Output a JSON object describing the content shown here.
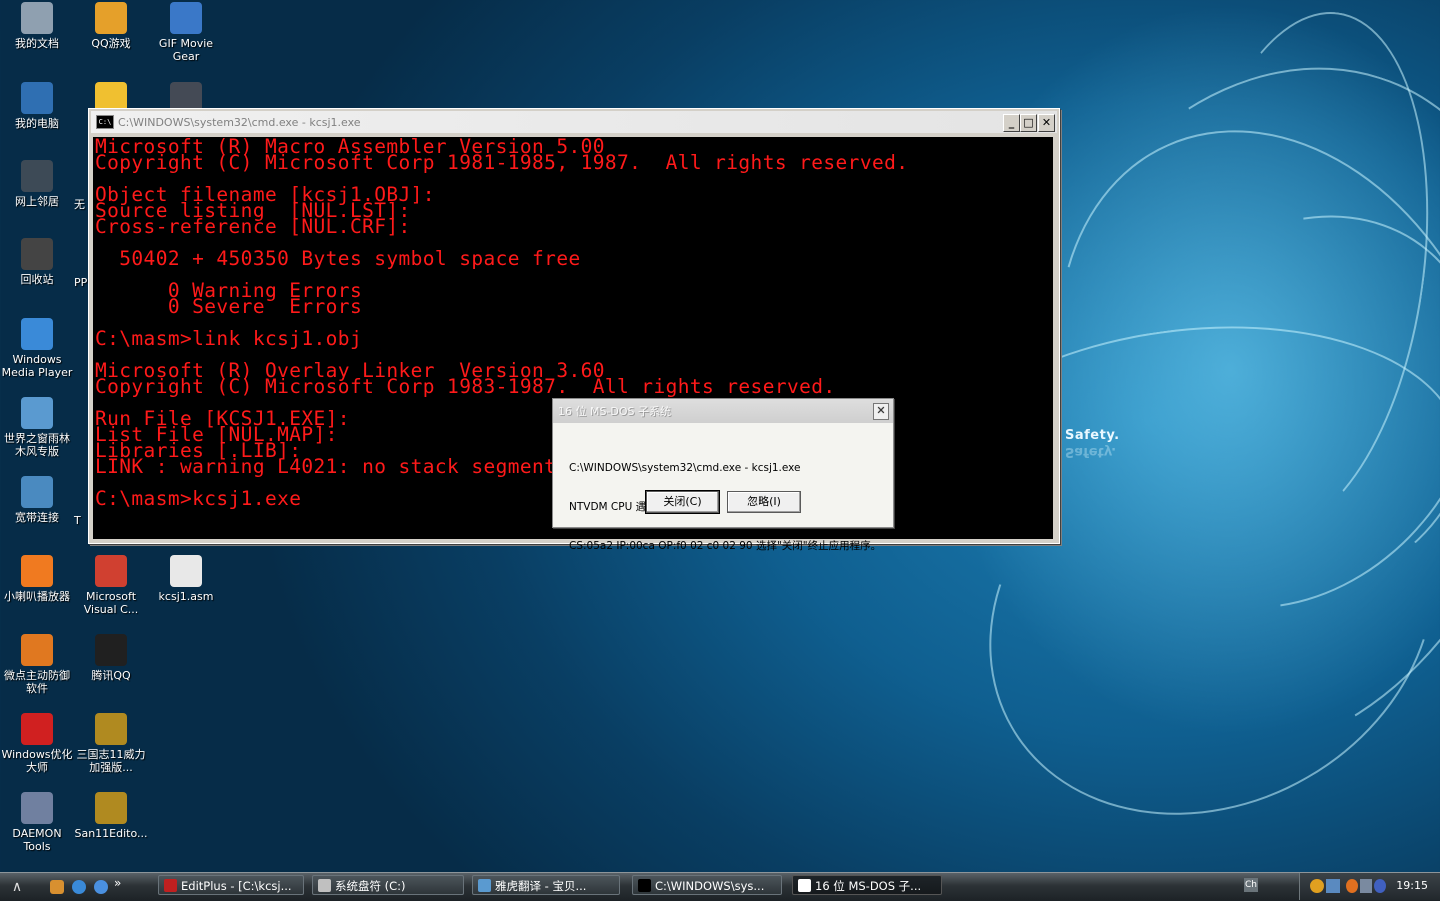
{
  "desktop": {
    "wallpaper_text": "Safety.",
    "icons": [
      {
        "label": "我的文档",
        "icon": "documents-icon",
        "color": "#8fa0b0"
      },
      {
        "label": "QQ游戏",
        "icon": "qq-game-icon",
        "color": "#e5a02a"
      },
      {
        "label": "GIF Movie Gear",
        "icon": "gif-movie-gear-icon",
        "color": "#3a78c8"
      },
      {
        "label": "我的电脑",
        "icon": "my-computer-icon",
        "color": "#2f6fb2"
      },
      {
        "label": "",
        "icon": "media-shortcut-icon",
        "color": "#f0c030"
      },
      {
        "label": "",
        "icon": "game-shortcut-icon",
        "color": "#444a55"
      },
      {
        "label": "网上邻居",
        "icon": "network-icon",
        "color": "#3d4a56"
      },
      {
        "label": "无",
        "icon": "partial-icon",
        "color": "#30506a"
      },
      {
        "label": "回收站",
        "icon": "recycle-bin-icon",
        "color": "#444"
      },
      {
        "label": "PP",
        "icon": "partial-icon-2",
        "color": "#30506a"
      },
      {
        "label": "Windows Media Player",
        "icon": "media-player-icon",
        "color": "#3a8ad8"
      },
      {
        "label": "世界之窗雨林木风专版",
        "icon": "browser-icon",
        "color": "#5a9ad0"
      },
      {
        "label": "宽带连接",
        "icon": "broadband-icon",
        "color": "#4a8ac0"
      },
      {
        "label": "T",
        "icon": "partial-icon-3",
        "color": "#30506a"
      },
      {
        "label": "小喇叭播放器",
        "icon": "speaker-player-icon",
        "color": "#f07a20"
      },
      {
        "label": "Microsoft Visual C...",
        "icon": "visual-c-icon",
        "color": "#d04030"
      },
      {
        "label": "kcsj1.asm",
        "icon": "asm-file-icon",
        "color": "#e8e8e8"
      },
      {
        "label": "微点主动防御软件",
        "icon": "antivirus-icon",
        "color": "#e07820"
      },
      {
        "label": "腾讯QQ",
        "icon": "qq-icon",
        "color": "#202020"
      },
      {
        "label": "Windows优化大师",
        "icon": "optimizer-icon",
        "color": "#d02020"
      },
      {
        "label": "三国志11威力加强版...",
        "icon": "sanguo-icon",
        "color": "#b08a20"
      },
      {
        "label": "DAEMON Tools",
        "icon": "daemon-tools-icon",
        "color": "#7080a0"
      },
      {
        "label": "San11Edito...",
        "icon": "san11-editor-icon",
        "color": "#b08a20"
      }
    ]
  },
  "cmd_window": {
    "title": "C:\\WINDOWS\\system32\\cmd.exe - kcsj1.exe",
    "buttons": {
      "minimize": "_",
      "maximize": "□",
      "close": "✕"
    },
    "console_lines": [
      "Microsoft (R) Macro Assembler Version 5.00",
      "Copyright (C) Microsoft Corp 1981-1985, 1987.  All rights reserved.",
      "",
      "Object filename [kcsj1.OBJ]:",
      "Source listing  [NUL.LST]:",
      "Cross-reference [NUL.CRF]:",
      "",
      "  50402 + 450350 Bytes symbol space free",
      "",
      "      0 Warning Errors",
      "      0 Severe  Errors",
      "",
      "C:\\masm>link kcsj1.obj",
      "",
      "Microsoft (R) Overlay Linker  Version 3.60",
      "Copyright (C) Microsoft Corp 1983-1987.  All rights reserved.",
      "",
      "Run File [KCSJ1.EXE]:",
      "List File [NUL.MAP]:",
      "Libraries [.LIB]:",
      "LINK : warning L4021: no stack segment",
      "",
      "C:\\masm>kcsj1.exe"
    ],
    "console_color": "#ff1a1a"
  },
  "dialog": {
    "title": "16 位 MS-DOS 子系统",
    "close": "✕",
    "message_lines": [
      "C:\\WINDOWS\\system32\\cmd.exe - kcsj1.exe",
      "NTVDM CPU 遇到无效的指令。",
      "CS:05a2 IP:00ca OP:f0 02 c0 02 90 选择\"关闭\"终止应用程序。"
    ],
    "close_button": "关闭(C)",
    "ignore_button": "忽略(I)"
  },
  "taskbar": {
    "start": "∧",
    "quick_launch_more": "»",
    "tasks": [
      {
        "label": "EditPlus - [C:\\kcsj...",
        "icon": "editplus-icon",
        "color": "#c02020"
      },
      {
        "label": "系统盘符 (C:)",
        "icon": "drive-icon",
        "color": "#c0c0c0"
      },
      {
        "label": "雅虎翻译 - 宝贝...",
        "icon": "browser-icon",
        "color": "#5a9ad0"
      },
      {
        "label": "C:\\WINDOWS\\sys...",
        "icon": "cmd-icon",
        "color": "#000000"
      },
      {
        "label": "16 位 MS-DOS 子...",
        "icon": "window-icon",
        "color": "#ffffff"
      }
    ],
    "ime": "Ch",
    "clock": "19:15"
  }
}
